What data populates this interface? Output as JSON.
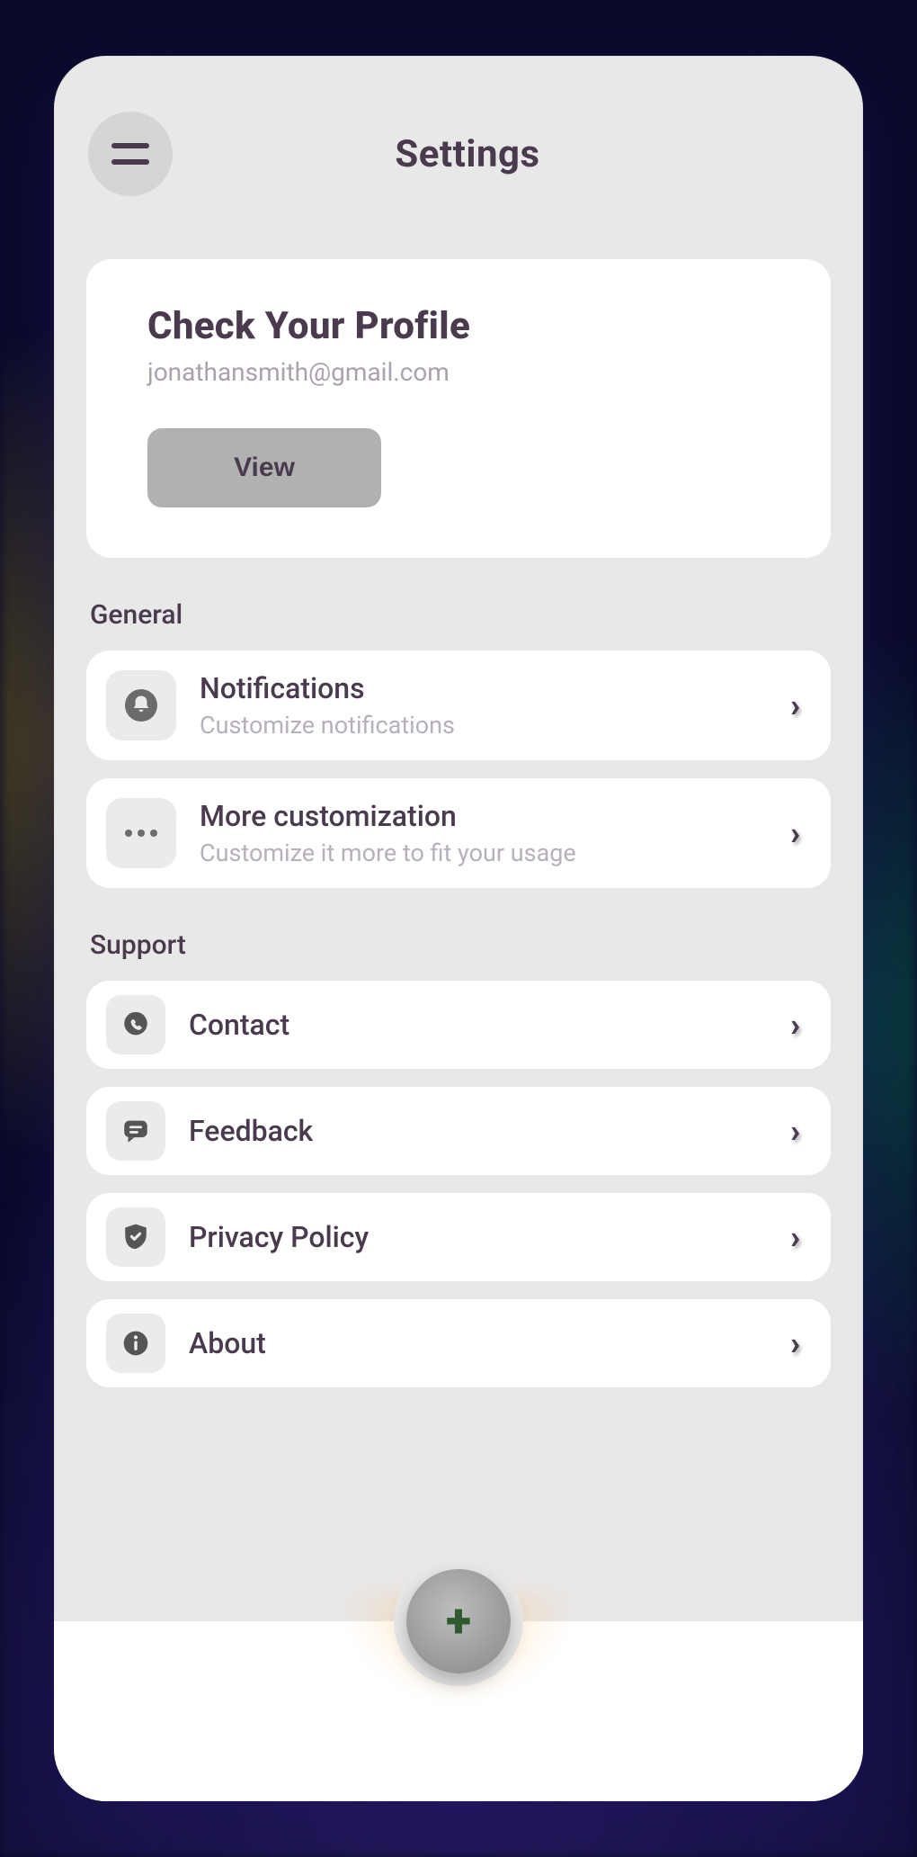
{
  "header": {
    "title": "Settings"
  },
  "profile_card": {
    "heading": "Check Your Profile",
    "email": "jonathansmith@gmail.com",
    "button_label": "View"
  },
  "sections": {
    "general": {
      "label": "General",
      "notifications": {
        "title": "Notifications",
        "sub": "Customize notifications"
      },
      "more_custom": {
        "title": "More customization",
        "sub": "Customize it more to fit your usage"
      }
    },
    "support": {
      "label": "Support",
      "contact": {
        "title": "Contact"
      },
      "feedback": {
        "title": "Feedback"
      },
      "privacy": {
        "title": "Privacy Policy"
      },
      "about": {
        "title": "About"
      }
    }
  }
}
